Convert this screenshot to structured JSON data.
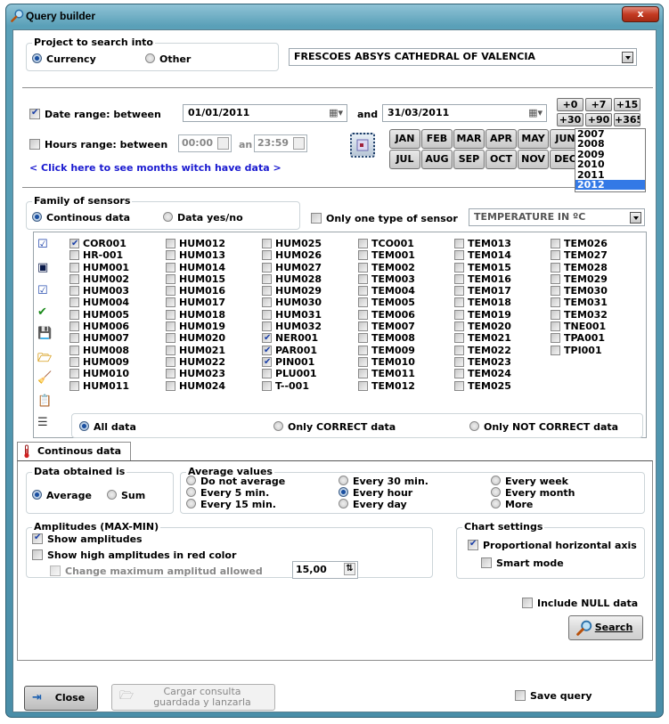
{
  "window": {
    "title": "Query builder",
    "close_label": "x"
  },
  "project": {
    "group_label": "Project to search into",
    "options": [
      {
        "label": "Currency",
        "selected": true
      },
      {
        "label": "Other",
        "selected": false
      }
    ],
    "selected_project": "FRESCOES ABSYS CATHEDRAL OF VALENCIA"
  },
  "dates": {
    "date_range_label": "Date range: between",
    "date_range_checked": true,
    "from_date": "01/01/2011",
    "and_label": "and",
    "to_date": "31/03/2011",
    "quick_buttons": [
      "+0",
      "+7",
      "+15",
      "+30",
      "+90",
      "+365"
    ],
    "hours_range_label": "Hours range: between",
    "hours_range_checked": false,
    "from_time": "00:00",
    "and_short_label": "an",
    "to_time": "23:59",
    "months_link": "< Click here to see months witch have data >",
    "months": [
      "JAN",
      "FEB",
      "MAR",
      "APR",
      "MAY",
      "JUN",
      "JUL",
      "AUG",
      "SEP",
      "OCT",
      "NOV",
      "DEC"
    ],
    "years": [
      "2007",
      "2008",
      "2009",
      "2010",
      "2011",
      "2012"
    ],
    "selected_year": "2012"
  },
  "sensors": {
    "family_label": "Family of sensors",
    "family_options": [
      {
        "label": "Continous data",
        "selected": true
      },
      {
        "label": "Data yes/no",
        "selected": false
      }
    ],
    "one_type_label": "Only one type of sensor",
    "one_type_checked": false,
    "sensor_type": "TEMPERATURE IN ºC",
    "list": [
      {
        "name": "COR001",
        "checked": true
      },
      {
        "name": "HR-001",
        "checked": false
      },
      {
        "name": "HUM001",
        "checked": false
      },
      {
        "name": "HUM002",
        "checked": false
      },
      {
        "name": "HUM003",
        "checked": false
      },
      {
        "name": "HUM004",
        "checked": false
      },
      {
        "name": "HUM005",
        "checked": false
      },
      {
        "name": "HUM006",
        "checked": false
      },
      {
        "name": "HUM007",
        "checked": false
      },
      {
        "name": "HUM008",
        "checked": false
      },
      {
        "name": "HUM009",
        "checked": false
      },
      {
        "name": "HUM010",
        "checked": false
      },
      {
        "name": "HUM011",
        "checked": false
      },
      {
        "name": "HUM012",
        "checked": false
      },
      {
        "name": "HUM013",
        "checked": false
      },
      {
        "name": "HUM014",
        "checked": false
      },
      {
        "name": "HUM015",
        "checked": false
      },
      {
        "name": "HUM016",
        "checked": false
      },
      {
        "name": "HUM017",
        "checked": false
      },
      {
        "name": "HUM018",
        "checked": false
      },
      {
        "name": "HUM019",
        "checked": false
      },
      {
        "name": "HUM020",
        "checked": false
      },
      {
        "name": "HUM021",
        "checked": false
      },
      {
        "name": "HUM022",
        "checked": false
      },
      {
        "name": "HUM023",
        "checked": false
      },
      {
        "name": "HUM024",
        "checked": false
      },
      {
        "name": "HUM025",
        "checked": false
      },
      {
        "name": "HUM026",
        "checked": false
      },
      {
        "name": "HUM027",
        "checked": false
      },
      {
        "name": "HUM028",
        "checked": false
      },
      {
        "name": "HUM029",
        "checked": false
      },
      {
        "name": "HUM030",
        "checked": false
      },
      {
        "name": "HUM031",
        "checked": false
      },
      {
        "name": "HUM032",
        "checked": false
      },
      {
        "name": "NER001",
        "checked": true
      },
      {
        "name": "PAR001",
        "checked": true
      },
      {
        "name": "PIN001",
        "checked": true
      },
      {
        "name": "PLU001",
        "checked": false
      },
      {
        "name": "T--001",
        "checked": false
      },
      {
        "name": "TCO001",
        "checked": false
      },
      {
        "name": "TEM001",
        "checked": false
      },
      {
        "name": "TEM002",
        "checked": false
      },
      {
        "name": "TEM003",
        "checked": false
      },
      {
        "name": "TEM004",
        "checked": false
      },
      {
        "name": "TEM005",
        "checked": false
      },
      {
        "name": "TEM006",
        "checked": false
      },
      {
        "name": "TEM007",
        "checked": false
      },
      {
        "name": "TEM008",
        "checked": false
      },
      {
        "name": "TEM009",
        "checked": false
      },
      {
        "name": "TEM010",
        "checked": false
      },
      {
        "name": "TEM011",
        "checked": false
      },
      {
        "name": "TEM012",
        "checked": false
      },
      {
        "name": "TEM013",
        "checked": false
      },
      {
        "name": "TEM014",
        "checked": false
      },
      {
        "name": "TEM015",
        "checked": false
      },
      {
        "name": "TEM016",
        "checked": false
      },
      {
        "name": "TEM017",
        "checked": false
      },
      {
        "name": "TEM018",
        "checked": false
      },
      {
        "name": "TEM019",
        "checked": false
      },
      {
        "name": "TEM020",
        "checked": false
      },
      {
        "name": "TEM021",
        "checked": false
      },
      {
        "name": "TEM022",
        "checked": false
      },
      {
        "name": "TEM023",
        "checked": false
      },
      {
        "name": "TEM024",
        "checked": false
      },
      {
        "name": "TEM025",
        "checked": false
      },
      {
        "name": "TEM026",
        "checked": false
      },
      {
        "name": "TEM027",
        "checked": false
      },
      {
        "name": "TEM028",
        "checked": false
      },
      {
        "name": "TEM029",
        "checked": false
      },
      {
        "name": "TEM030",
        "checked": false
      },
      {
        "name": "TEM031",
        "checked": false
      },
      {
        "name": "TEM032",
        "checked": false
      },
      {
        "name": "TNE001",
        "checked": false
      },
      {
        "name": "TPA001",
        "checked": false
      },
      {
        "name": "TPI001",
        "checked": false
      }
    ],
    "side_icons": [
      "check-all-icon",
      "uncheck-all-icon",
      "invert-selection-icon",
      "accept-icon",
      "save-icon",
      "open-folder-icon",
      "clear-broom-icon",
      "clipboard-icon",
      "list-icon"
    ],
    "data_filter": [
      {
        "label": "All data",
        "selected": true
      },
      {
        "label": "Only CORRECT data",
        "selected": false
      },
      {
        "label": "Only NOT CORRECT data",
        "selected": false
      }
    ]
  },
  "tab": {
    "label": "Continous data"
  },
  "continuous": {
    "data_obtained_label": "Data obtained is",
    "data_obtained_options": [
      {
        "label": "Average",
        "selected": true
      },
      {
        "label": "Sum",
        "selected": false
      }
    ],
    "average_label": "Average values",
    "average_options": [
      {
        "label": "Do not average",
        "selected": false
      },
      {
        "label": "Every 5 min.",
        "selected": false
      },
      {
        "label": "Every 15 min.",
        "selected": false
      },
      {
        "label": "Every 30 min.",
        "selected": false
      },
      {
        "label": "Every hour",
        "selected": true
      },
      {
        "label": "Every day",
        "selected": false
      },
      {
        "label": "Every week",
        "selected": false
      },
      {
        "label": "Every month",
        "selected": false
      },
      {
        "label": "More",
        "selected": false
      }
    ],
    "amplitudes_label": "Amplitudes (MAX-MIN)",
    "show_amplitudes": {
      "label": "Show amplitudes",
      "checked": true
    },
    "show_high_red": {
      "label": "Show high amplitudes in red color",
      "checked": false
    },
    "change_max": {
      "label": "Change maximum amplitud allowed",
      "checked": false
    },
    "max_amplitude_value": "15,00",
    "chart_settings_label": "Chart settings",
    "proportional_axis": {
      "label": "Proportional horizontal axis",
      "checked": true
    },
    "smart_mode": {
      "label": "Smart mode",
      "checked": false
    },
    "include_null": {
      "label": "Include NULL data",
      "checked": false
    },
    "search_label": "Search"
  },
  "footer": {
    "close_label": "Close",
    "load_query_line1": "Cargar consulta",
    "load_query_line2": "guardada y lanzarla",
    "save_query": {
      "label": "Save query",
      "checked": false
    }
  }
}
